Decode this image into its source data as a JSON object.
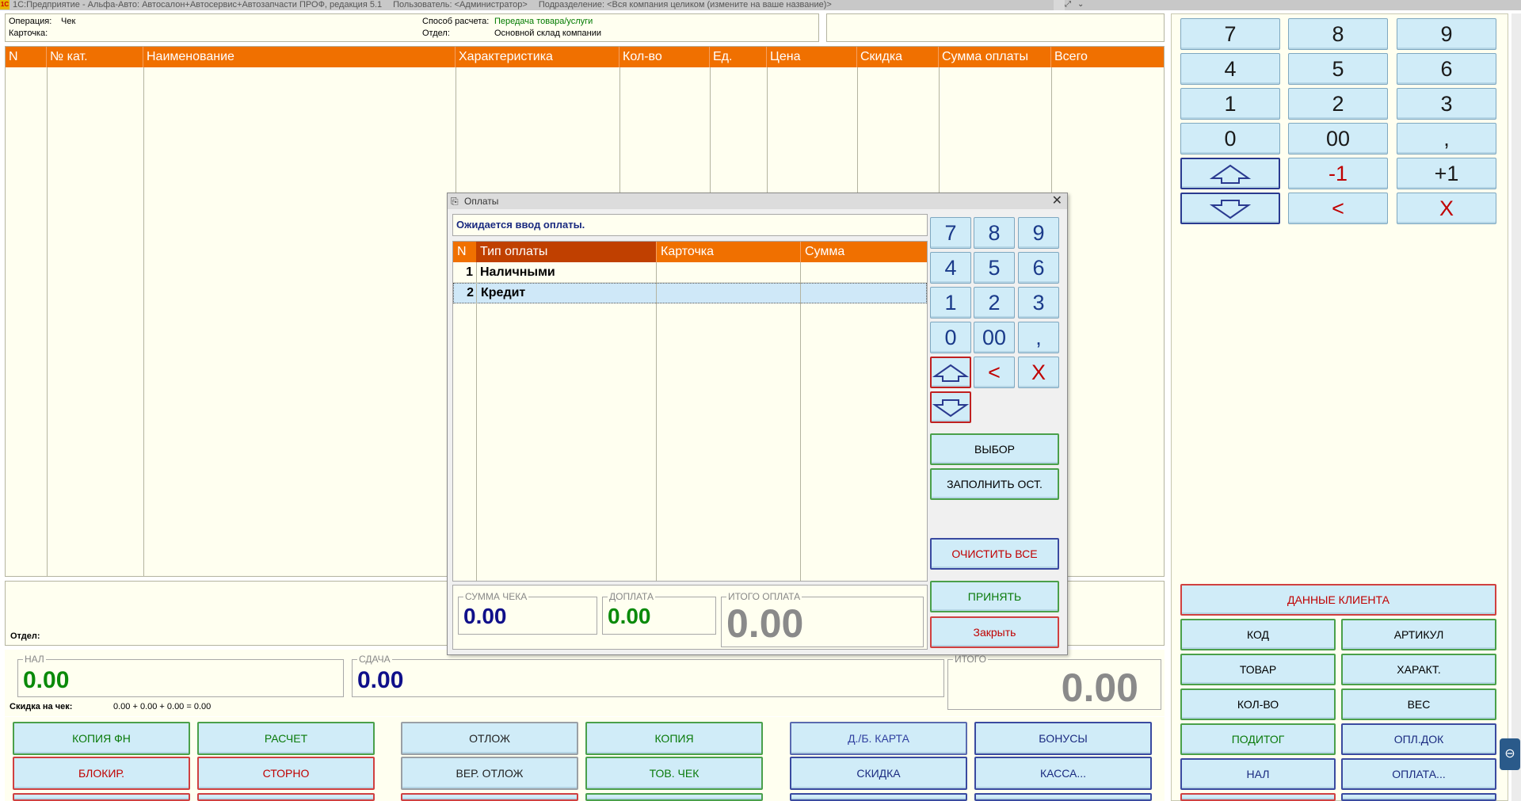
{
  "window": {
    "app_title": "1С:Предприятие - Альфа-Авто: Автосалон+Автосервис+Автозапчасти ПРОФ, редакция 5.1",
    "user": "Пользователь: <Администратор>",
    "division": "Подразделение: <Вся компания целиком (измените на ваше название)>",
    "logo": "1С"
  },
  "header": {
    "operation_label": "Операция:",
    "operation_value": "Чек",
    "card_label": "Карточка:",
    "payment_method_label": "Способ расчета:",
    "payment_method_value": "Передача товара/услуги",
    "department_label": "Отдел:",
    "department_value": "Основной склад компании"
  },
  "main_grid": {
    "columns": [
      "N",
      "№ кат.",
      "Наименование",
      "Характеристика",
      "Кол-во",
      "Ед.",
      "Цена",
      "Скидка",
      "Сумма оплаты",
      "Всего"
    ]
  },
  "bottom_panel": {
    "department_label": "Отдел:",
    "cash": {
      "label": "НАЛ",
      "value": "0.00"
    },
    "change": {
      "label": "СДАЧА",
      "value": "0.00"
    },
    "total": {
      "label": "ИТОГО",
      "value": "0.00"
    },
    "discount_label": "Скидка на чек:",
    "discount_value": "0.00 + 0.00 + 0.00 = 0.00"
  },
  "bottom_buttons": {
    "copy_fn": "КОПИЯ ФН",
    "calc": "РАСЧЕТ",
    "defer": "ОТЛОЖ",
    "copy": "КОПИЯ",
    "discount_card": "Д./Б. КАРТА",
    "bonuses": "БОНУСЫ",
    "block": "БЛОКИР.",
    "storno": "СТОРНО",
    "return_deferred": "ВЕР. ОТЛОЖ",
    "goods_check": "ТОВ. ЧЕК",
    "discount": "СКИДКА",
    "cash_register": "КАССА..."
  },
  "right_keypad": {
    "keys": [
      "7",
      "8",
      "9",
      "4",
      "5",
      "6",
      "1",
      "2",
      "3",
      "0",
      "00",
      ","
    ],
    "minus_one": "-1",
    "plus_one": "+1",
    "backspace": "<",
    "clear": "X"
  },
  "right_buttons": {
    "client_data": "ДАННЫЕ КЛИЕНТА",
    "code": "КОД",
    "article": "АРТИКУЛ",
    "goods": "ТОВАР",
    "characteristic": "ХАРАКТ.",
    "quantity": "КОЛ-ВО",
    "weight": "ВЕС",
    "subtotal": "ПОДИТОГ",
    "payment_doc": "ОПЛ.ДОК",
    "cash": "НАЛ",
    "payment": "ОПЛАТА..."
  },
  "dialog": {
    "title": "Оплаты",
    "status": "Ожидается ввод оплаты.",
    "columns": [
      "N",
      "Тип оплаты",
      "Карточка",
      "Сумма"
    ],
    "rows": [
      {
        "n": "1",
        "type": "Наличными",
        "card": "",
        "sum": ""
      },
      {
        "n": "2",
        "type": "Кредит",
        "card": "",
        "sum": ""
      }
    ],
    "keypad": {
      "keys": [
        "7",
        "8",
        "9",
        "4",
        "5",
        "6",
        "1",
        "2",
        "3",
        "0",
        "00",
        ","
      ],
      "backspace": "<",
      "clear": "X"
    },
    "buttons": {
      "select": "ВЫБОР",
      "fill_rest": "ЗАПОЛНИТЬ ОСТ.",
      "clear_all": "ОЧИСТИТЬ ВСЕ",
      "accept": "ПРИНЯТЬ",
      "close": "Закрыть"
    },
    "totals": {
      "check_sum": {
        "label": "СУММА ЧЕКА",
        "value": "0.00"
      },
      "surcharge": {
        "label": "ДОПЛАТА",
        "value": "0.00"
      },
      "total_paid": {
        "label": "ИТОГО ОПЛАТА",
        "value": "0.00"
      }
    }
  },
  "colors": {
    "grid_header": "#f07000",
    "grid_header_dark": "#c04000",
    "panel_bg": "#fffff0",
    "button_bg": "#d0ecf8",
    "selected_row": "#cfe8f8",
    "value_green": "#0a8a0a",
    "value_navy": "#10108a"
  }
}
